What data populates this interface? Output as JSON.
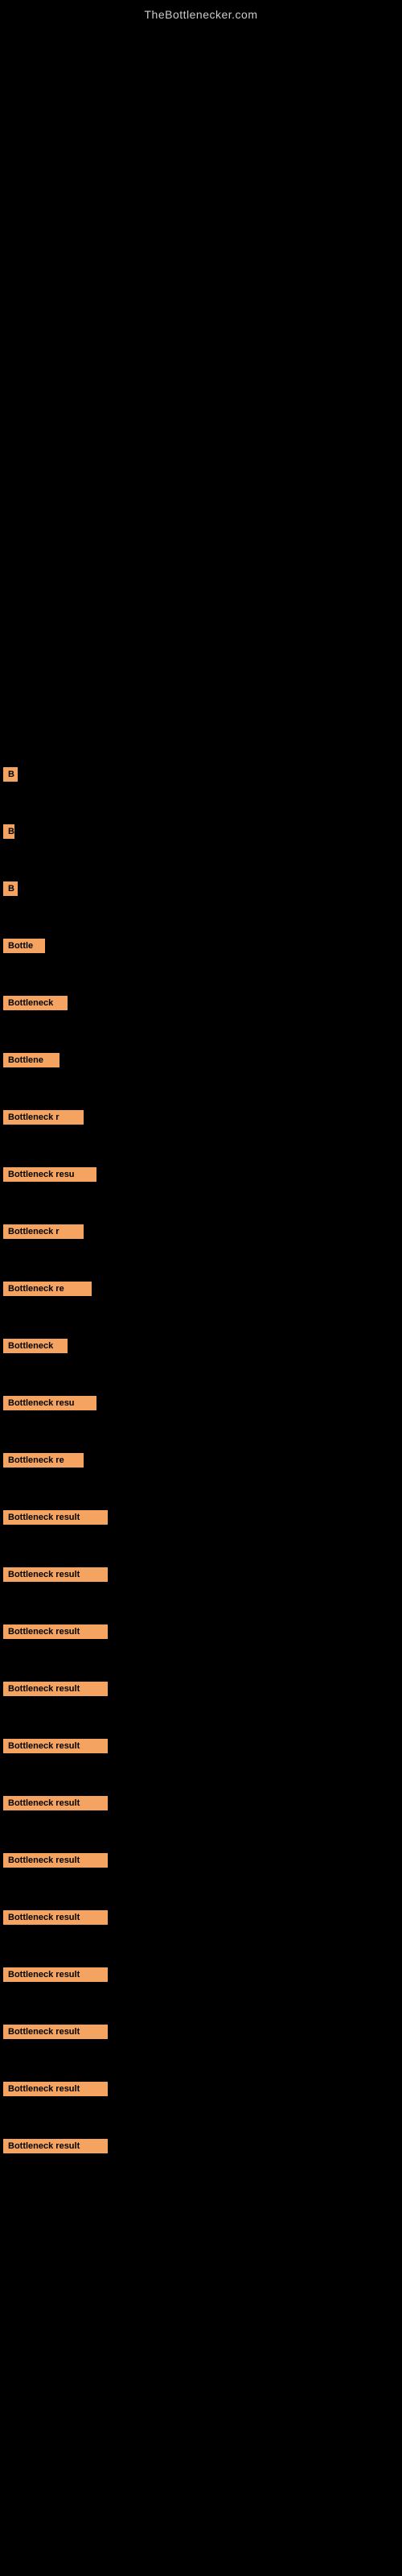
{
  "site": {
    "title": "TheBottlenecker.com"
  },
  "labels": [
    {
      "id": 1,
      "text": "B",
      "widthClass": "w1"
    },
    {
      "id": 2,
      "text": "B",
      "widthClass": "w2"
    },
    {
      "id": 3,
      "text": "B",
      "widthClass": "w3"
    },
    {
      "id": 4,
      "text": "Bottle",
      "widthClass": "w4"
    },
    {
      "id": 5,
      "text": "Bottleneck",
      "widthClass": "w5"
    },
    {
      "id": 6,
      "text": "Bottlene",
      "widthClass": "w6"
    },
    {
      "id": 7,
      "text": "Bottleneck r",
      "widthClass": "w7"
    },
    {
      "id": 8,
      "text": "Bottleneck resu",
      "widthClass": "w8"
    },
    {
      "id": 9,
      "text": "Bottleneck r",
      "widthClass": "w9"
    },
    {
      "id": 10,
      "text": "Bottleneck re",
      "widthClass": "w10"
    },
    {
      "id": 11,
      "text": "Bottleneck",
      "widthClass": "w11"
    },
    {
      "id": 12,
      "text": "Bottleneck resu",
      "widthClass": "w12"
    },
    {
      "id": 13,
      "text": "Bottleneck re",
      "widthClass": "w13"
    },
    {
      "id": 14,
      "text": "Bottleneck result",
      "widthClass": "w14"
    },
    {
      "id": 15,
      "text": "Bottleneck result",
      "widthClass": "w15"
    },
    {
      "id": 16,
      "text": "Bottleneck result",
      "widthClass": "w16"
    },
    {
      "id": 17,
      "text": "Bottleneck result",
      "widthClass": "w17"
    },
    {
      "id": 18,
      "text": "Bottleneck result",
      "widthClass": "w18"
    },
    {
      "id": 19,
      "text": "Bottleneck result",
      "widthClass": "w19"
    },
    {
      "id": 20,
      "text": "Bottleneck result",
      "widthClass": "w20"
    },
    {
      "id": 21,
      "text": "Bottleneck result",
      "widthClass": "w21"
    },
    {
      "id": 22,
      "text": "Bottleneck result",
      "widthClass": "w22"
    },
    {
      "id": 23,
      "text": "Bottleneck result",
      "widthClass": "w23"
    },
    {
      "id": 24,
      "text": "Bottleneck result",
      "widthClass": "w24"
    },
    {
      "id": 25,
      "text": "Bottleneck result",
      "widthClass": "w25"
    }
  ]
}
